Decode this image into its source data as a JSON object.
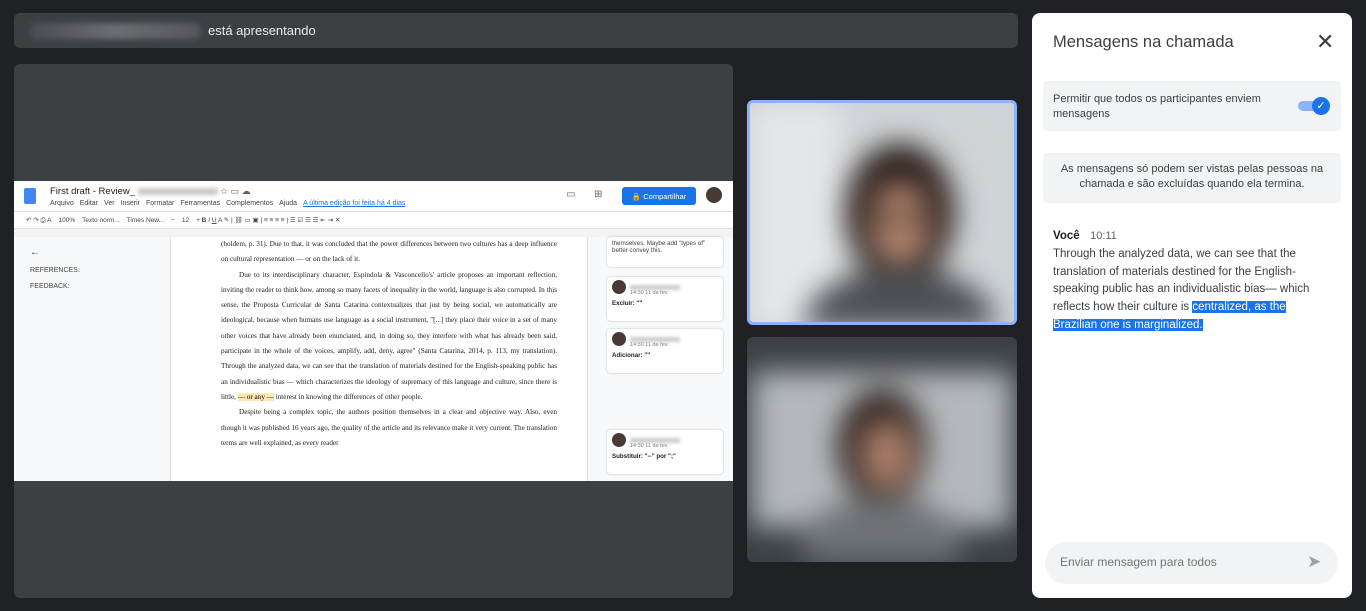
{
  "presenter": {
    "status_text": "está apresentando"
  },
  "document": {
    "title": "First draft - Review_",
    "menu": [
      "Arquivo",
      "Editar",
      "Ver",
      "Inserir",
      "Formatar",
      "Ferramentas",
      "Complementos",
      "Ajuda"
    ],
    "last_edit": "A última edição foi feita há 4 dias",
    "share_label": "Compartilhar",
    "toolbar": [
      "100%",
      "Texto norm...",
      "Times New...",
      "12"
    ],
    "outline": [
      "REFERENCES:",
      "FEEDBACK:"
    ],
    "paragraphs": {
      "p0": "(holdem, p. 31). Due to that, it was concluded that the power differences between two cultures has a deep influence on cultural representation — or on the lack of it.",
      "p1": "Due to its interdisciplinary character, Espíndola & Vasconcello's' article proposes an important reflection, inviting the reader to think how, among so many facets of inequality in the world, language is also corrupted. In this sense, the Proposta Curricular de Santa Catarina contextualizes that just by being social, we automatically are ideological, because when humans use language as a social instrument, \"[...] they place their voice in a set of many other voices that have already been enunciated, and, in doing so, they interfere with what has already been said, participate in the whole of the voices, amplify, add, deny, agree\" (Santa Catarina, 2014, p. 113, my translation). Through the analyzed data, we can see that the translation of materials destined for the English-speaking public has an individualistic bias — which characterizes the ideology of supremacy of this language and culture, since there is little,",
      "p1_mark": "— or any —",
      "p1_end": "interest in knowing the differences of other people.",
      "p2": "Despite being a complex topic, the authors position themselves in a clear and objective way. Also, even though it was published 16 years ago, the quality of the article and its relevance make it very current. The translation terms are well explained, as every reader"
    },
    "comments": [
      {
        "text": "themselves. Maybe add \"types of\" better convey this."
      },
      {
        "time": "14:30 11 de fev.",
        "action": "Excluir: \"\""
      },
      {
        "time": "14:30 11 de fev.",
        "action": "Adicionar: \"\""
      },
      {
        "time": "14:30 11 de fev.",
        "action": "Substituir: \"--\" por \";\""
      }
    ]
  },
  "chat": {
    "title": "Mensagens na chamada",
    "permission_text": "Permitir que todos os participantes enviem mensagens",
    "permission_enabled": true,
    "info_text": "As mensagens só podem ser vistas pelas pessoas na chamada e são excluídas quando ela termina.",
    "messages": [
      {
        "sender": "Você",
        "time": "10:11",
        "text": "Through the analyzed data, we can see that the translation of materials destined for the English-speaking public has an individualistic bias— which reflects how their culture is ",
        "selected_text": "centralized, as the Brazilian one is marginalized."
      }
    ],
    "input_placeholder": "Enviar mensagem para todos"
  },
  "colors": {
    "accent": "#1a73e8",
    "tile_highlight": "#8ab4f8",
    "background": "#202124",
    "topbar": "#3c4043"
  },
  "icons": [
    "close-icon",
    "send-icon",
    "check-icon",
    "docs-logo-icon"
  ]
}
